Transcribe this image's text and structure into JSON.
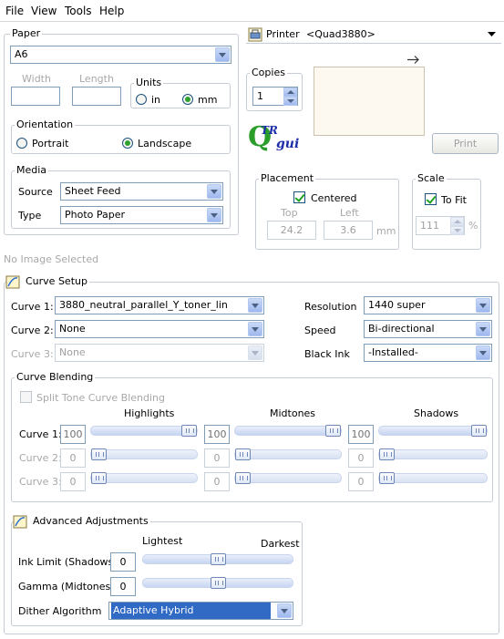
{
  "menu": {
    "file": "File",
    "view": "View",
    "tools": "Tools",
    "help": "Help"
  },
  "paper": {
    "legend": "Paper",
    "size": "A6",
    "width_label": "Width",
    "length_label": "Length",
    "width_value": "",
    "length_value": "",
    "units_legend": "Units",
    "unit_in": "in",
    "unit_mm": "mm",
    "orientation_legend": "Orientation",
    "portrait": "Portrait",
    "landscape": "Landscape",
    "media_legend": "Media",
    "source_label": "Source",
    "source_value": "Sheet Feed",
    "type_label": "Type",
    "type_value": "Photo Paper"
  },
  "printer": {
    "label": "Printer",
    "value": "<Quad3880>",
    "copies_legend": "Copies",
    "copies_value": "1",
    "print_button": "Print",
    "logo_top": "TR",
    "logo_bottom": "gui",
    "logo_q": "Q"
  },
  "placement": {
    "legend": "Placement",
    "centered": "Centered",
    "top_label": "Top",
    "left_label": "Left",
    "top_value": "24.2",
    "left_value": "3.6",
    "unit": "mm"
  },
  "scale": {
    "legend": "Scale",
    "to_fit": "To Fit",
    "value": "111",
    "unit": "%"
  },
  "status": {
    "no_image": "No Image Selected"
  },
  "curve_setup": {
    "legend": "Curve Setup",
    "curve1_label": "Curve 1:",
    "curve1_value": "3880_neutral_parallel_Y_toner_lin",
    "curve2_label": "Curve 2:",
    "curve2_value": "None",
    "curve3_label": "Curve 3:",
    "curve3_value": "None",
    "resolution_label": "Resolution",
    "resolution_value": "1440 super",
    "speed_label": "Speed",
    "speed_value": "Bi-directional",
    "black_ink_label": "Black Ink",
    "black_ink_value": "-Installed-"
  },
  "blending": {
    "legend": "Curve Blending",
    "split_tone": "Split Tone Curve Blending",
    "highlights": "Highlights",
    "midtones": "Midtones",
    "shadows": "Shadows",
    "rows": [
      {
        "label": "Curve 1:",
        "h": "100",
        "m": "100",
        "s": "100",
        "h_level": 1.0,
        "m_level": 1.0,
        "s_level": 1.0
      },
      {
        "label": "Curve 2:",
        "h": "0",
        "m": "0",
        "s": "0",
        "h_level": 0.0,
        "m_level": 0.0,
        "s_level": 0.0
      },
      {
        "label": "Curve 3:",
        "h": "0",
        "m": "0",
        "s": "0",
        "h_level": 0.0,
        "m_level": 0.0,
        "s_level": 0.0
      }
    ]
  },
  "advanced": {
    "legend": "Advanced Adjustments",
    "lightest": "Lightest",
    "darkest": "Darkest",
    "ink_limit_label": "Ink Limit (Shadows)",
    "ink_limit_value": "0",
    "ink_limit_level": 0.5,
    "gamma_label": "Gamma (Midtones)",
    "gamma_value": "0",
    "gamma_level": 0.5,
    "dither_label": "Dither Algorithm",
    "dither_value": "Adaptive Hybrid"
  },
  "colors": {
    "accent": "#316ac5",
    "border": "#7f9db9",
    "preview": "#fdf9f0",
    "logo_green": "#2a9d2a",
    "logo_blue": "#1d2fa8"
  }
}
